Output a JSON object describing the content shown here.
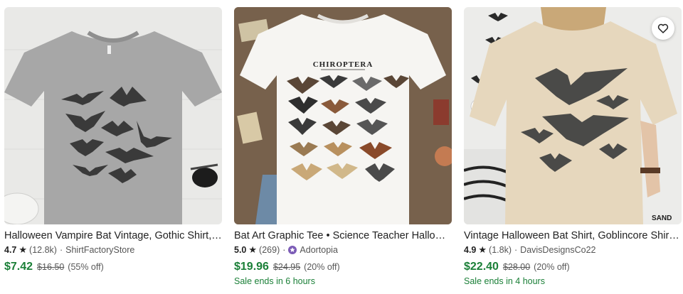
{
  "listings": [
    {
      "title": "Halloween Vampire Bat Vintage, Gothic Shirt, ...",
      "rating": "4.7",
      "reviews": "(12.8k)",
      "shop": "ShirtFactoryStore",
      "price": "$7.42",
      "original_price": "$16.50",
      "discount": "(55% off)",
      "sale_text": ""
    },
    {
      "title": "Bat Art Graphic Tee • Science Teacher Hallowe...",
      "rating": "5.0",
      "reviews": "(269)",
      "shop": "Adortopia",
      "price": "$19.96",
      "original_price": "$24.95",
      "discount": "(20% off)",
      "sale_text": "Sale ends in 6 hours",
      "shirt_print_text": "CHIROPTERA"
    },
    {
      "title": "Vintage Halloween Bat Shirt, Goblincore Shirt,...",
      "rating": "4.9",
      "reviews": "(1.8k)",
      "shop": "DavisDesignsCo22",
      "price": "$22.40",
      "original_price": "$28.00",
      "discount": "(20% off)",
      "sale_text": "Sale ends in 4 hours",
      "shirt_tag_text": "SAND"
    }
  ],
  "icons": {
    "star": "star-icon",
    "favorite": "heart-outline-icon",
    "star_seller": "star-seller-badge-icon"
  },
  "colors": {
    "price_green": "#1a7f37",
    "text": "#222222",
    "muted": "#595959",
    "badge_purple": "#7b5bb6"
  }
}
